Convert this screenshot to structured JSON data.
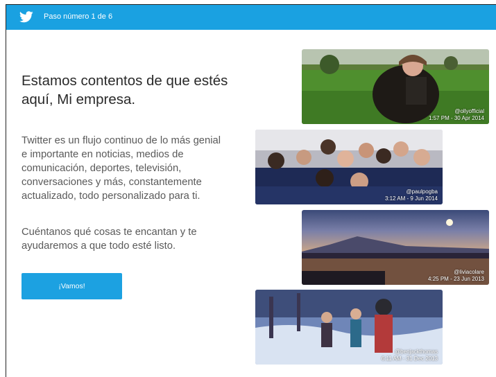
{
  "header": {
    "logo": "twitter-bird-icon",
    "step": "Paso número 1 de 6",
    "color": "#1aa1e1"
  },
  "main": {
    "title": "Estamos contentos de que estés aquí, Mi empresa.",
    "paragraph1": "Twitter es un flujo continuo de lo más genial e importante en noticias, medios de comunicación, deportes, televisión, conversaciones y más, constantemente actualizado, todo personalizado para ti.",
    "paragraph2": "Cuéntanos qué cosas te encantan y te ayudaremos a que todo esté listo.",
    "cta_label": "¡Vamos!"
  },
  "photos": [
    {
      "handle": "@ollyofficial",
      "time": "1:57 PM - 30 Apr 2014"
    },
    {
      "handle": "@paulpogba",
      "time": "3:12 AM - 9 Jun 2014"
    },
    {
      "handle": "@liviacolare",
      "time": "4:25 PM - 23 Jun 2013"
    },
    {
      "handle": "@benjackthomas",
      "time": "6:11 AM - 31 Dec 2013"
    }
  ]
}
